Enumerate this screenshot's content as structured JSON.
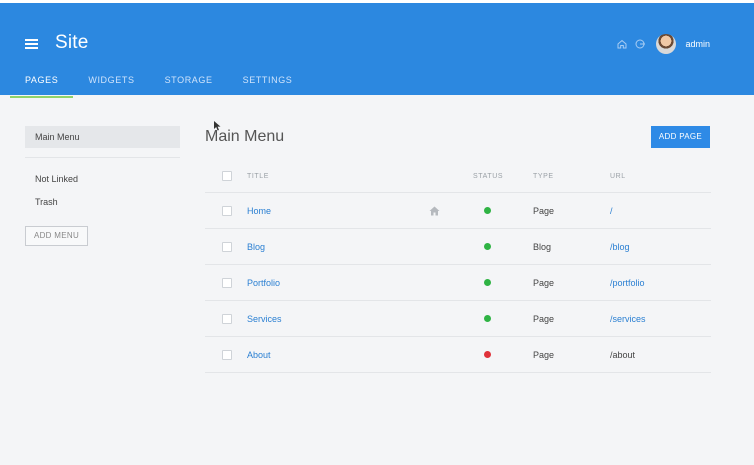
{
  "header": {
    "title": "Site",
    "user_name": "admin",
    "tabs": [
      {
        "label": "PAGES",
        "active": true
      },
      {
        "label": "WIDGETS",
        "active": false
      },
      {
        "label": "STORAGE",
        "active": false
      },
      {
        "label": "SETTINGS",
        "active": false
      }
    ],
    "icons": [
      "hamburger-menu-icon",
      "home-icon",
      "logout-icon",
      "avatar"
    ]
  },
  "sidebar": {
    "active_menu": "Main Menu",
    "items": [
      "Not Linked",
      "Trash"
    ],
    "add_menu_label": "ADD MENU"
  },
  "main": {
    "title": "Main Menu",
    "add_page_label": "ADD PAGE",
    "columns": [
      "TITLE",
      "STATUS",
      "TYPE",
      "URL"
    ],
    "rows": [
      {
        "title": "Home",
        "is_home": true,
        "status": "active",
        "type": "Page",
        "url": "/"
      },
      {
        "title": "Blog",
        "is_home": false,
        "status": "active",
        "type": "Blog",
        "url": "/blog"
      },
      {
        "title": "Portfolio",
        "is_home": false,
        "status": "active",
        "type": "Page",
        "url": "/portfolio"
      },
      {
        "title": "Services",
        "is_home": false,
        "status": "active",
        "type": "Page",
        "url": "/services"
      },
      {
        "title": "About",
        "is_home": false,
        "status": "inactive",
        "type": "Page",
        "url": "/about"
      }
    ]
  },
  "colors": {
    "header_bg": "#2c88e0",
    "accent": "#2e8ae6",
    "tab_underline": "#8fd36a",
    "status_active": "#2fb344",
    "status_inactive": "#e0323a",
    "link": "#2a7fd2"
  }
}
